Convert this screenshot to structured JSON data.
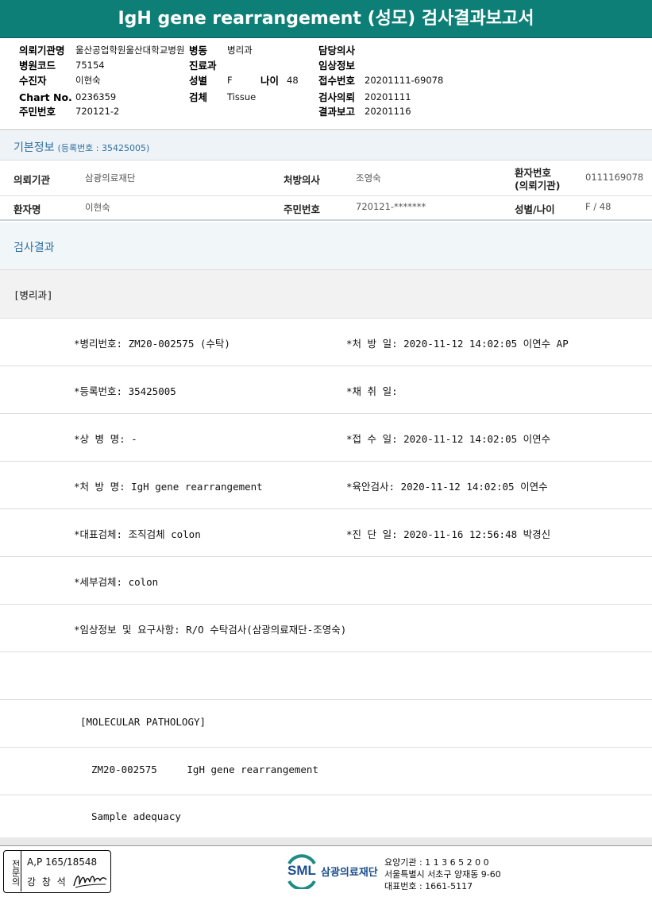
{
  "title": "IgH gene rearrangement (성모) 검사결과보고서",
  "header": {
    "request_org_label": "의뢰기관명",
    "request_org_value": "울산공업학원울산대학교병원",
    "ward_label": "병동",
    "ward_value": "병리과",
    "doctor_label": "담당의사",
    "doctor_value": "",
    "hospital_code_label": "병원코드",
    "hospital_code_value": "75154",
    "dept_label": "진료과",
    "dept_value": "",
    "clinical_info_label": "임상정보",
    "clinical_info_value": "",
    "patient_label": "수진자",
    "patient_value": "이현숙",
    "sex_label": "성별",
    "sex_value": "F",
    "age_label": "나이",
    "age_value": "48",
    "receipt_no_label": "접수번호",
    "receipt_no_value": "20201111-69078",
    "chart_label": "Chart No.",
    "chart_value": "0236359",
    "specimen_label": "검체",
    "specimen_value": "Tissue",
    "request_date_label": "검사의뢰",
    "request_date_value": "20201111",
    "id_label": "주민번호",
    "id_value": "720121-2",
    "report_date_label": "결과보고",
    "report_date_value": "20201116"
  },
  "basic_info": {
    "title": "기본정보",
    "reg_no": "(등록번호 : 35425005)",
    "row1": {
      "org_label": "의뢰기관",
      "org_value": "삼광의료재단",
      "doctor_label": "처방의사",
      "doctor_value": "조영숙",
      "patient_no_label_1": "환자번호",
      "patient_no_label_2": "(의뢰기관)",
      "patient_no_value": "0111169078"
    },
    "row2": {
      "name_label": "환자명",
      "name_value": "이현숙",
      "id_label": "주민번호",
      "id_value": "720121-*******",
      "sex_age_label": "성별/나이",
      "sex_age_value": "F / 48"
    }
  },
  "results": {
    "title": "검사결과",
    "dept": "[병리과]",
    "lines": [
      {
        "left": "*병리번호: ZM20-002575 (수탁)",
        "right": "*처 방 일: 2020-11-12 14:02:05  이연수 AP"
      },
      {
        "left": "*등록번호: 35425005",
        "right": "*채 취 일:"
      },
      {
        "left": "*상 병 명: -",
        "right": "*접 수 일: 2020-11-12 14:02:05  이연수"
      },
      {
        "left": "*처 방 명: IgH gene rearrangement",
        "right": "*육안검사: 2020-11-12 14:02:05  이연수"
      },
      {
        "left": "*대표검체: 조직검체 colon",
        "right": "*진 단 일: 2020-11-16 12:56:48  박경신"
      },
      {
        "left": "*세부검체: colon",
        "right": ""
      },
      {
        "left": "*임상정보 및 요구사항: R/O 수탁검사(삼광의료재단-조영숙)",
        "right": ""
      }
    ],
    "mol_title": "[MOLECULAR PATHOLOGY]",
    "mol_line": "ZM20-002575     IgH gene rearrangement",
    "sample_line": "Sample adequacy"
  },
  "footer": {
    "stamp_side": "전문의",
    "stamp_line1": "A,P 165/18548",
    "stamp_line2": "강 창 석",
    "logo_text": "SML",
    "org_name": "삼광의료재단",
    "line1": "요양기관 : 1 1 3 6 5 2 0 0",
    "line2": "서울특별시 서초구 양재동 9-60",
    "line3": "대표번호 : 1661-5117"
  },
  "colors": {
    "title_bg": "#0e7f77",
    "section_title": "#2f6f9f",
    "section_band": "#eef3f7"
  }
}
